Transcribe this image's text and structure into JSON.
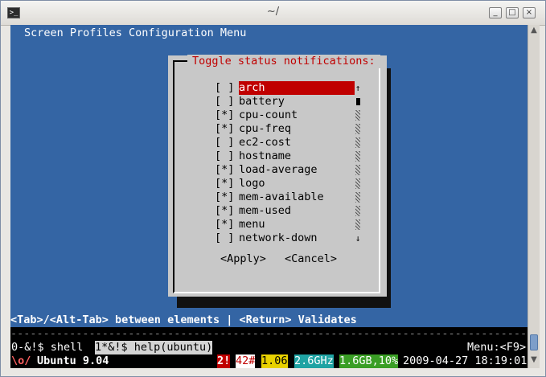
{
  "window": {
    "title": "~/",
    "app_icon_glyph": ">_",
    "controls": [
      "_",
      "□",
      "×"
    ]
  },
  "terminal": {
    "header": "Screen Profiles Configuration Menu",
    "dialog": {
      "title": "Toggle status notifications:",
      "items": [
        {
          "mark": "[ ]",
          "label": "arch",
          "selected": true
        },
        {
          "mark": "[ ]",
          "label": "battery"
        },
        {
          "mark": "[*]",
          "label": "cpu-count"
        },
        {
          "mark": "[*]",
          "label": "cpu-freq"
        },
        {
          "mark": "[ ]",
          "label": "ec2-cost"
        },
        {
          "mark": "[ ]",
          "label": "hostname"
        },
        {
          "mark": "[*]",
          "label": "load-average"
        },
        {
          "mark": "[*]",
          "label": "logo"
        },
        {
          "mark": "[*]",
          "label": "mem-available"
        },
        {
          "mark": "[*]",
          "label": "mem-used"
        },
        {
          "mark": "[*]",
          "label": "menu"
        },
        {
          "mark": "[ ]",
          "label": "network-down"
        }
      ],
      "scroll_up": "↑",
      "scroll_down": "↓",
      "apply": "<Apply>",
      "cancel": "<Cancel>"
    },
    "help": "<Tab>/<Alt-Tab> between elements | <Return> Validates",
    "divider": "----------------------------------------------------------------------------------------------------",
    "status": {
      "windows_left": "0-&!$ shell",
      "windows_active": "1*&!$ help(ubuntu)",
      "menu_hint": "Menu:<F9>",
      "logo": "\\o/",
      "distro": "Ubuntu 9.04",
      "updates": "2!",
      "cpu_count": "42#",
      "load": "1.06",
      "cpu_freq": "2.6GHz",
      "mem": "1.6GB,10%",
      "datetime": "2009-04-27 18:19:01"
    },
    "colors": {
      "background": "#3465a4",
      "selection": "#c00000",
      "dialog": "#c8c8c8"
    }
  }
}
